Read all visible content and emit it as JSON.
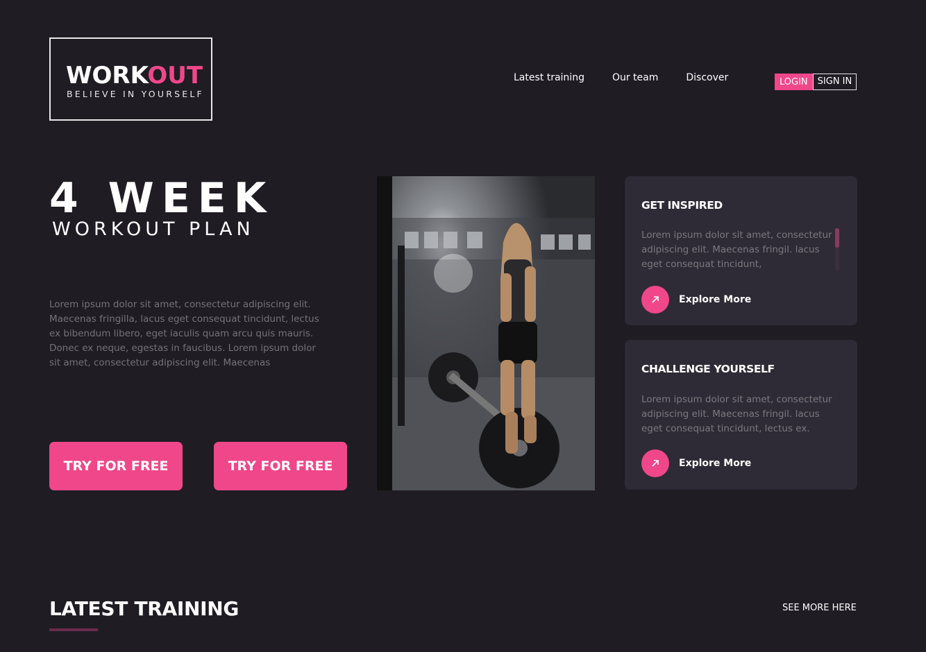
{
  "logo": {
    "word_white": "WORK",
    "word_pink": "OUT",
    "tagline": "BELIEVE IN YOURSELF"
  },
  "nav": {
    "items": [
      "Latest training",
      "Our team",
      "Discover"
    ]
  },
  "auth": {
    "login": "LOGIN",
    "signin": "SIGN IN"
  },
  "hero": {
    "title": "4 WEEK",
    "subtitle": "WORKOUT PLAN",
    "text": "Lorem ipsum dolor sit amet, consectetur adipiscing elit. Maecenas fringilla, lacus eget consequat tincidunt, lectus ex bibendum libero, eget iaculis quam arcu quis mauris. Donec ex neque, egestas in faucibus. Lorem ipsum dolor sit amet, consectetur adipiscing elit. Maecenas",
    "cta_primary": "TRY FOR FREE",
    "cta_secondary": "TRY FOR FREE"
  },
  "cards": [
    {
      "title": "GET INSPIRED",
      "text": "Lorem ipsum dolor sit amet, consectetur adipiscing elit. Maecenas fringil. lacus eget consequat tincidunt,",
      "link": "Explore More"
    },
    {
      "title": "CHALLENGE YOURSELF",
      "text": "Lorem ipsum dolor sit amet, consectetur adipiscing elit. Maecenas fringil. lacus eget consequat tincidunt, lectus ex.",
      "link": "Explore More"
    }
  ],
  "latest": {
    "title": "LATEST TRAINING",
    "see_more": "SEE MORE HERE"
  },
  "colors": {
    "accent": "#f0478a",
    "background": "#1f1c24",
    "card": "#2f2b36"
  },
  "icons": {
    "explore": "arrow-up-right-icon"
  }
}
